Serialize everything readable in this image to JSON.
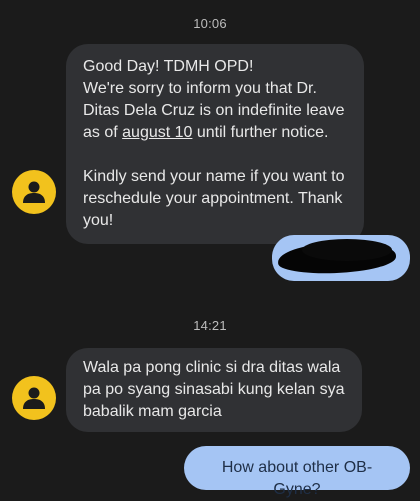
{
  "thread": {
    "timestamp_1": "10:06",
    "timestamp_2": "14:21",
    "messages": [
      {
        "direction": "incoming",
        "avatar_icon": "person-icon",
        "paragraph_1_before": "Good Day! TDMH OPD!\nWe're sorry to inform you that Dr. Ditas Dela Cruz is on indefinite leave as of ",
        "paragraph_1_underlined": "august 10",
        "paragraph_1_after": " until further notice.",
        "paragraph_2": "Kindly send your name if you want to reschedule your appointment. Thank you!"
      },
      {
        "direction": "outgoing",
        "redacted": true
      },
      {
        "direction": "incoming",
        "avatar_icon": "person-icon",
        "text": "Wala pa pong  clinic si dra ditas wala pa po syang sinasabi kung kelan sya babalik mam garcia"
      },
      {
        "direction": "outgoing",
        "text": "How about other OB-Gyne?"
      }
    ]
  },
  "colors": {
    "background": "#1b1b1b",
    "incoming_bubble": "#303134",
    "outgoing_bubble": "#a5c5f4",
    "avatar": "#f2c21d"
  }
}
